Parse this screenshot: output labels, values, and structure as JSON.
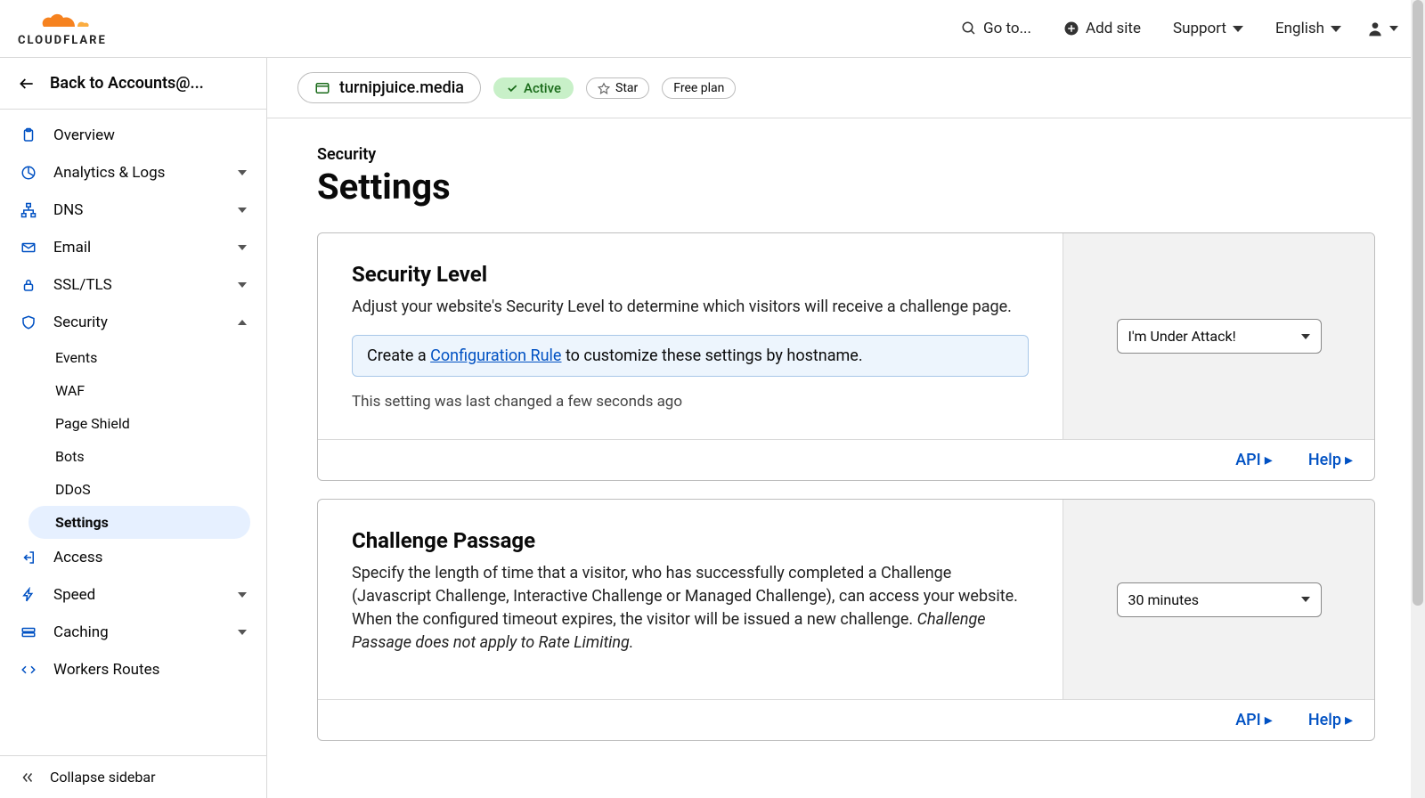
{
  "header": {
    "goto": "Go to...",
    "add_site": "Add site",
    "support": "Support",
    "language": "English"
  },
  "sidebar": {
    "back": "Back to Accounts@...",
    "collapse": "Collapse sidebar",
    "items": {
      "overview": "Overview",
      "analytics": "Analytics & Logs",
      "dns": "DNS",
      "email": "Email",
      "ssl": "SSL/TLS",
      "security": "Security",
      "access": "Access",
      "speed": "Speed",
      "caching": "Caching",
      "workers": "Workers Routes"
    },
    "security_sub": {
      "events": "Events",
      "waf": "WAF",
      "page_shield": "Page Shield",
      "bots": "Bots",
      "ddos": "DDoS",
      "settings": "Settings"
    }
  },
  "domain": {
    "name": "turnipjuice.media",
    "status": "Active",
    "star": "Star",
    "plan": "Free plan"
  },
  "page": {
    "eyebrow": "Security",
    "title": "Settings"
  },
  "cards": {
    "security_level": {
      "title": "Security Level",
      "desc": "Adjust your website's Security Level to determine which visitors will receive a challenge page.",
      "note_prefix": "Create a ",
      "note_link": "Configuration Rule",
      "note_suffix": " to customize these settings by hostname.",
      "meta": "This setting was last changed a few seconds ago",
      "select_value": "I'm Under Attack!"
    },
    "challenge_passage": {
      "title": "Challenge Passage",
      "desc": "Specify the length of time that a visitor, who has successfully completed a Challenge (Javascript Challenge, Interactive Challenge or Managed Challenge), can access your website. When the configured timeout expires, the visitor will be issued a new challenge. ",
      "desc_italic": "Challenge Passage does not apply to Rate Limiting.",
      "select_value": "30 minutes"
    },
    "footer": {
      "api": "API",
      "help": "Help"
    }
  }
}
